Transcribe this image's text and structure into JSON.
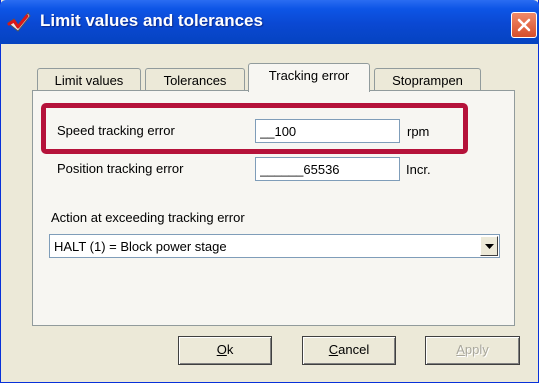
{
  "window": {
    "title": "Limit values and tolerances",
    "icon": "red-check-app-icon",
    "close_icon": "close-icon"
  },
  "tabs": [
    {
      "label": "Limit values",
      "active": false
    },
    {
      "label": "Tolerances",
      "active": false
    },
    {
      "label": "Tracking error",
      "active": true
    },
    {
      "label": "Stoprampen",
      "active": false
    }
  ],
  "tracking": {
    "speed_label": "Speed tracking error",
    "speed_value": "__100",
    "speed_unit": "rpm",
    "position_label": "Position tracking error",
    "position_value": "______65536",
    "position_unit": "Incr.",
    "action_label": "Action at exceeding tracking error",
    "action_value": "HALT (1) = Block power stage"
  },
  "buttons": {
    "ok_mnemonic": "O",
    "ok_rest": "k",
    "cancel_mnemonic": "C",
    "cancel_rest": "ancel",
    "apply_mnemonic": "A",
    "apply_rest": "pply"
  },
  "colors": {
    "title_bar": "#0A48D2",
    "highlight_border": "#B5123A",
    "dialog_bg": "#ECE9D8",
    "tab_panel_bg": "#F7F6F2"
  }
}
